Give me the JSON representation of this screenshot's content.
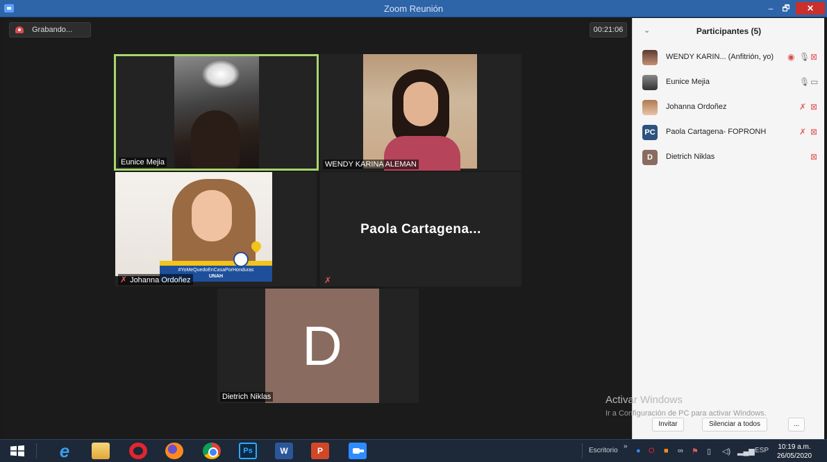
{
  "window": {
    "title": "Zoom Reunión",
    "minimize_label": "–",
    "maximize_label": "🗗",
    "close_label": "✕"
  },
  "meeting": {
    "recording_label": "Grabando...",
    "timer": "00:21:06",
    "tiles": [
      {
        "name": "Eunice Mejia",
        "active_speaker": true,
        "muted": false
      },
      {
        "name": "WENDY KARINA ALEMAN",
        "muted": false
      },
      {
        "name": "Johanna Ordoñez",
        "muted": true
      },
      {
        "name": "Paola Cartagena...",
        "muted": true
      },
      {
        "name": "Dietrich Niklas",
        "avatar_letter": "D"
      }
    ],
    "johanna_banner": {
      "hashtag": "#YoMeQuedoEnCasaPorHonduras",
      "org": "UNAH"
    }
  },
  "participants": {
    "header": "Participantes (5)",
    "items": [
      {
        "name": "WENDY KARIN... (Anfitrión, yo)",
        "avatar": "photo",
        "recording": true,
        "mic": "on",
        "video": "off"
      },
      {
        "name": "Eunice Mejia",
        "avatar": "photo",
        "mic": "on",
        "video": "on"
      },
      {
        "name": "Johanna Ordoñez",
        "avatar": "photo",
        "mic": "off",
        "video": "off"
      },
      {
        "name": "Paola Cartagena- FOPRONH",
        "avatar_text": "PC",
        "mic": "off",
        "video": "off"
      },
      {
        "name": "Dietrich Niklas",
        "avatar_text": "D",
        "video": "off"
      }
    ],
    "invite_label": "Invitar",
    "mute_all_label": "Silenciar a todos",
    "more_label": "..."
  },
  "watermark": {
    "line1": "Activar Windows",
    "line2": "Ir a Configuración de PC para activar Windows."
  },
  "taskbar": {
    "desktop_label": "Escritorio",
    "language": "ESP",
    "time": "10:19 a.m.",
    "date": "26/05/2020",
    "ps_label": "Ps",
    "word_label": "W",
    "ppt_label": "P"
  },
  "colors": {
    "active_speaker_border": "#a8d66d",
    "muted_red": "#e35b5b",
    "titlebar_blue": "#2e64a8",
    "close_red": "#c9302c"
  }
}
